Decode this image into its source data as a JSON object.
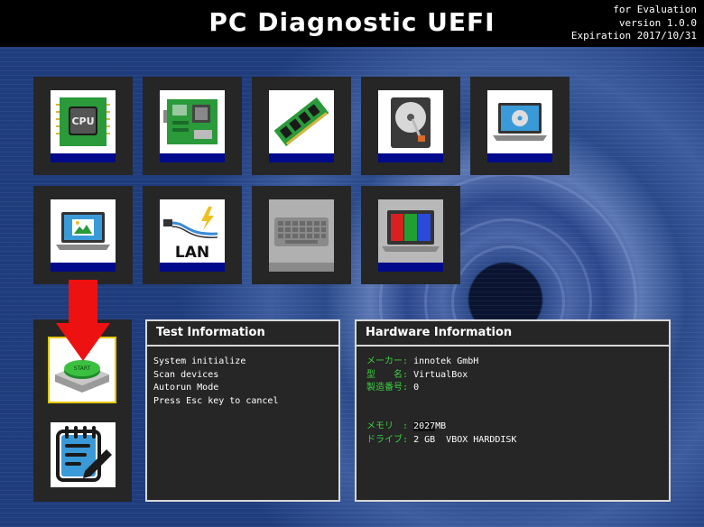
{
  "header": {
    "title": "PC Diagnostic UEFI",
    "edition": "for Evaluation",
    "version": "version 1.0.0",
    "expiration": "Expiration 2017/10/31"
  },
  "tiles": [
    {
      "icon": "cpu-icon",
      "label": "CPU",
      "enabled": true
    },
    {
      "icon": "motherboard-icon",
      "enabled": true
    },
    {
      "icon": "memory-icon",
      "enabled": true
    },
    {
      "icon": "hard-disk-icon",
      "enabled": true
    },
    {
      "icon": "optical-drive-laptop-icon",
      "enabled": true
    },
    {
      "icon": "display-laptop-icon",
      "enabled": true
    },
    {
      "icon": "lan-icon",
      "label": "LAN",
      "enabled": true
    },
    {
      "icon": "keyboard-icon",
      "enabled": false
    },
    {
      "icon": "color-bars-laptop-icon",
      "enabled": true
    }
  ],
  "start_button": {
    "label": "START",
    "icon": "start-button-icon"
  },
  "log_button": {
    "icon": "notepad-edit-icon"
  },
  "test_info": {
    "title": "Test Information",
    "lines": [
      "System initialize",
      "Scan devices",
      "Autorun Mode",
      "Press Esc key to cancel"
    ]
  },
  "hardware_info": {
    "title": "Hardware Information",
    "maker_label": "メーカー:",
    "maker_value": "innotek GmbH",
    "model_label": "型　　名:",
    "model_value": "VirtualBox",
    "serial_label": "製造番号:",
    "serial_value": "0",
    "memory_label": "メモリ　:",
    "memory_value": "2027",
    "memory_unit": "MB",
    "drive_label": "ドライブ:",
    "drive_value": "2 GB  VBOX HARDDISK"
  },
  "colors": {
    "accent_strip": "#000a8a",
    "label_green": "#3cd040",
    "start_border": "#e5c700",
    "arrow": "#ee1111"
  }
}
